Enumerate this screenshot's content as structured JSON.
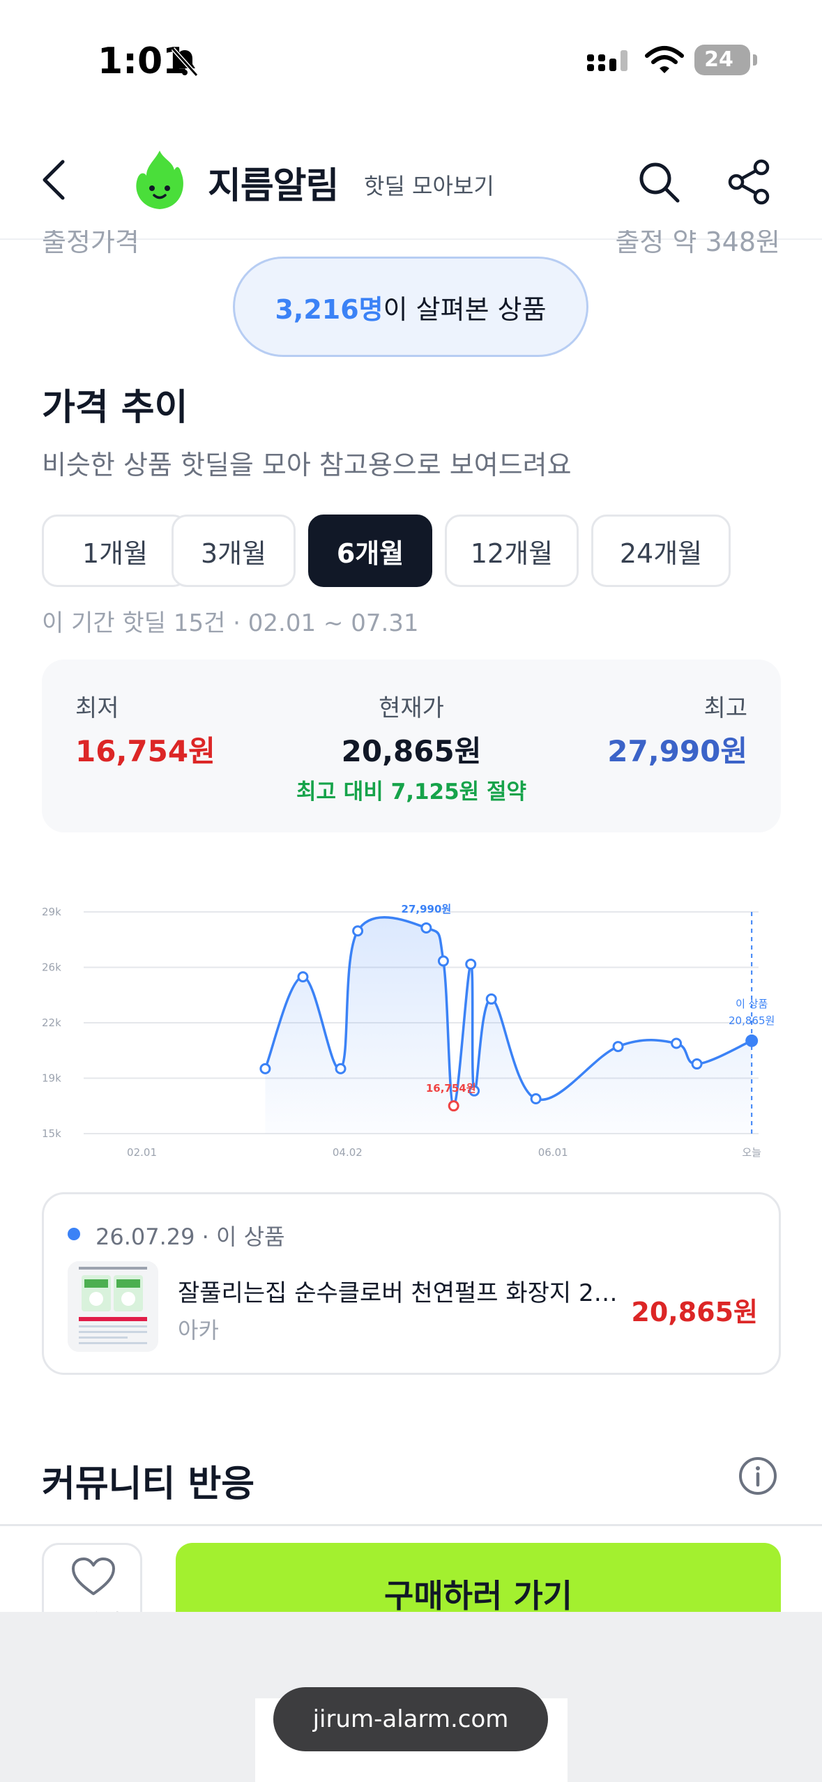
{
  "status_bar": {
    "time": "1:01",
    "battery": "24"
  },
  "header": {
    "brand": "지름알림",
    "subtitle": "핫딜 모아보기"
  },
  "partial_row": {
    "left": "출정가격",
    "right": "출정 약 348원"
  },
  "viewers": {
    "count": "3,216명",
    "suffix": "이 살펴본 상품"
  },
  "price_trend": {
    "title": "가격 추이",
    "description": "비슷한 상품 핫딜을 모아 참고용으로 보여드려요",
    "periods": [
      {
        "label": "1개월",
        "active": false
      },
      {
        "label": "3개월",
        "active": false
      },
      {
        "label": "6개월",
        "active": true
      },
      {
        "label": "12개월",
        "active": false
      },
      {
        "label": "24개월",
        "active": false
      }
    ],
    "period_info": "이 기간 핫딜 15건 · 02.01 ~ 07.31"
  },
  "stats": {
    "min_label": "최저",
    "min_value": "16,754원",
    "current_label": "현재가",
    "current_value": "20,865원",
    "max_label": "최고",
    "max_value": "27,990원",
    "saving": "최고 대비 7,125원 절약",
    "colors": {
      "min": "#dc2626",
      "max": "#3b63c8",
      "saving": "#16a34a"
    }
  },
  "chart_data": {
    "type": "line",
    "y_ticks": [
      "29k",
      "26k",
      "22k",
      "19k",
      "15k"
    ],
    "x_ticks": [
      "02.01",
      "04.02",
      "06.01",
      "오늘"
    ],
    "ylim": [
      15000,
      29000
    ],
    "points": [
      {
        "x": "03.09",
        "y": 19100
      },
      {
        "x": "03.20",
        "y": 24900
      },
      {
        "x": "03.31",
        "y": 19100
      },
      {
        "x": "04.05",
        "y": 27800
      },
      {
        "x": "04.25",
        "y": 27990
      },
      {
        "x": "04.30",
        "y": 25900
      },
      {
        "x": "05.03",
        "y": 16754
      },
      {
        "x": "05.08",
        "y": 25700
      },
      {
        "x": "05.09",
        "y": 17700
      },
      {
        "x": "05.14",
        "y": 23500
      },
      {
        "x": "05.27",
        "y": 17200
      },
      {
        "x": "06.20",
        "y": 20500
      },
      {
        "x": "07.07",
        "y": 20700
      },
      {
        "x": "07.13",
        "y": 19400
      },
      {
        "x": "07.29",
        "y": 20865
      }
    ],
    "max_label": "27,990원",
    "min_label": "16,754원",
    "current_label_line1": "이 상품",
    "current_label_line2": "20,865원",
    "colors": {
      "line": "#3b82f6",
      "min": "#ef4444",
      "grid": "#e5e7eb"
    },
    "grid": true
  },
  "deal": {
    "meta": "26.07.29 · 이 상품",
    "title": "잘풀리는집 순수클로버 천연펄프 화장지 27...",
    "seller": "아카",
    "price": "20,865원"
  },
  "community": {
    "title": "커뮤니티 반응"
  },
  "bottom": {
    "like_label": "찜하기",
    "buy_label": "구매하러 가기",
    "accent": "#a3f02f"
  },
  "browser": {
    "url": "jirum-alarm.com"
  }
}
